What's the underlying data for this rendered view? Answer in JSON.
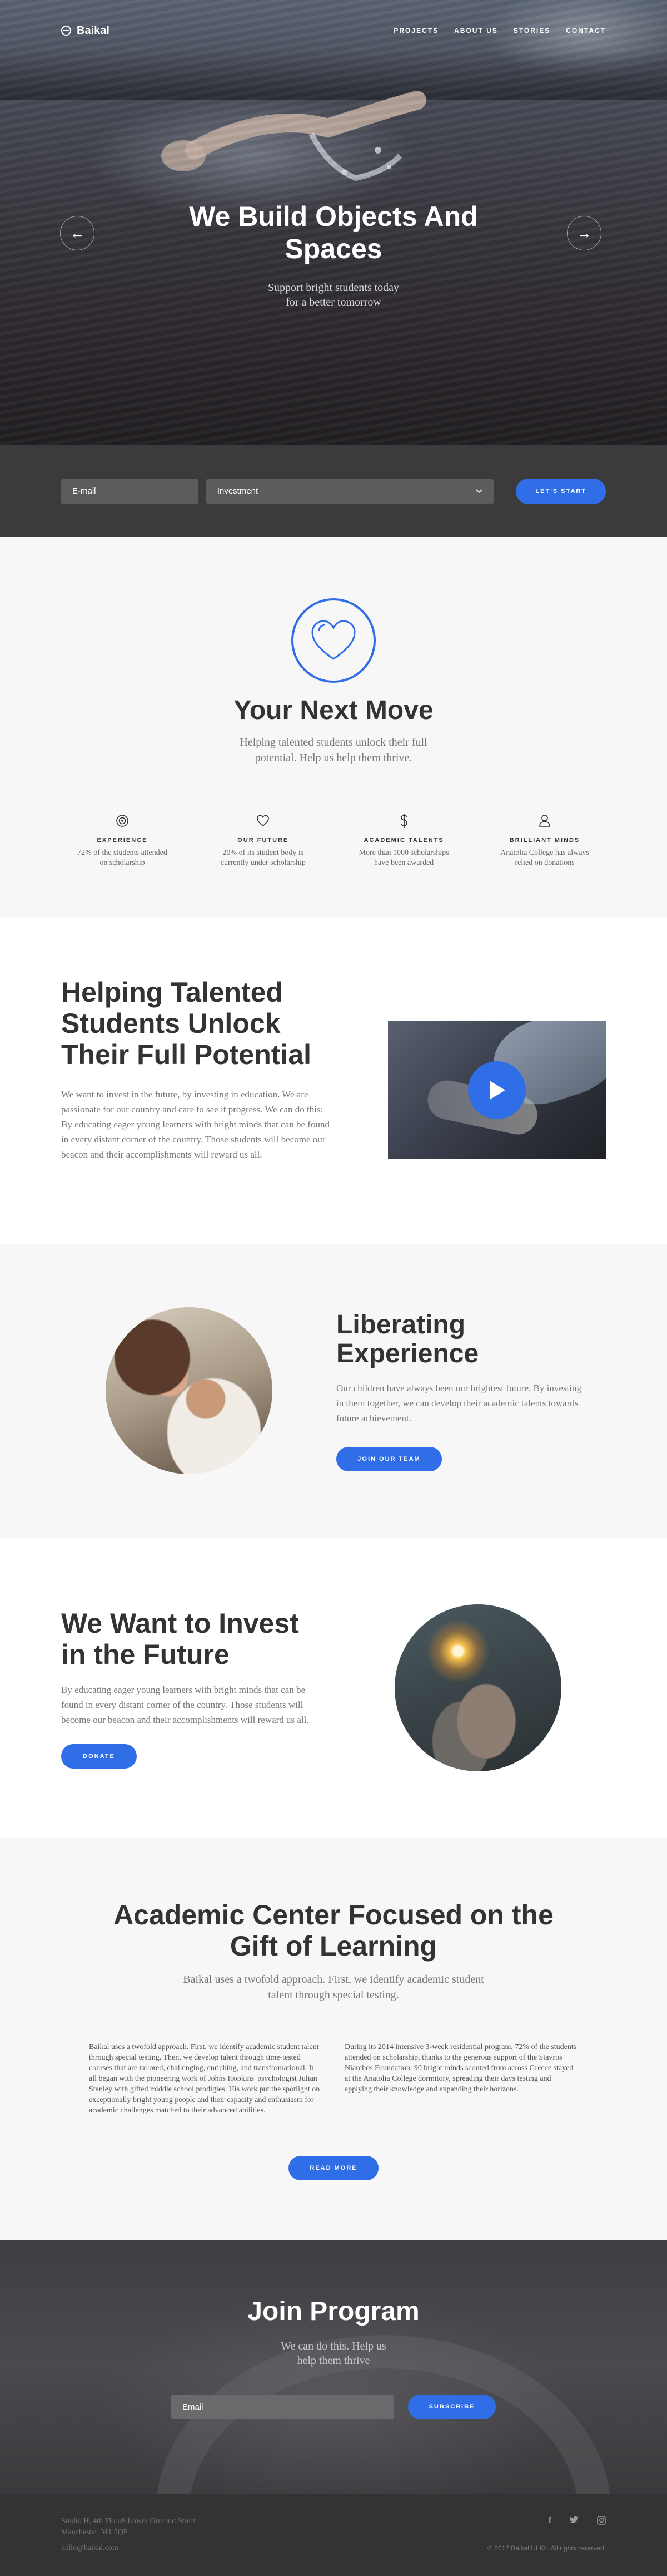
{
  "nav": {
    "brand": "Baikal",
    "items": [
      "PROJECTS",
      "ABOUT US",
      "STORIES",
      "CONTACT"
    ]
  },
  "hero": {
    "title": "We Build Objects And Spaces",
    "subtitle": "Support bright students today for a better tomorrow",
    "prev_icon": "arrow-left-icon",
    "next_icon": "arrow-right-icon"
  },
  "signup": {
    "email_placeholder": "E-mail",
    "select_value": "Investment",
    "button": "LET'S START"
  },
  "next_move": {
    "title": "Your Next Move",
    "subtitle": "Helping talented students unlock their full potential. Help us help them thrive.",
    "features": [
      {
        "icon": "target-icon",
        "title": "EXPERIENCE",
        "text": "72% of the students attended on scholarship"
      },
      {
        "icon": "heart-icon",
        "title": "OUR FUTURE",
        "text": "20% of its student body is currently under scholarship"
      },
      {
        "icon": "dollar-icon",
        "title": "ACADEMIC TALENTS",
        "text": "More than 1000 scholarships have been awarded"
      },
      {
        "icon": "user-icon",
        "title": "BRILLIANT MINDS",
        "text": "Anatolia College has always relied on donations"
      }
    ]
  },
  "helping": {
    "title": "Helping Talented Students Unlock Their Full Potential",
    "body": "We want to invest in the future, by investing in education. We are passionate for our country and care to see it progress. We can do this: By educating eager young learners with bright minds that can be found in every distant corner of the country. Those students will become our beacon and their accomplishments will reward us all."
  },
  "liberating": {
    "title": "Liberating Experience",
    "body": "Our children have always been our brightest future. By investing in them together, we can develop their academic talents towards future achievement.",
    "button": "JOIN OUR TEAM"
  },
  "invest": {
    "title": "We Want to Invest in the Future",
    "body": "By educating eager young learners with bright minds that can be found in every distant corner of the country. Those students will become our beacon and their accomplishments will reward us all.",
    "button": "DONATE"
  },
  "academic": {
    "title": "Academic Center Focused on the Gift of Learning",
    "subtitle": "Baikal uses a twofold approach. First, we identify academic student talent through special testing.",
    "col1": "Baikal uses a twofold approach. First, we identify academic student talent through special testing. Then, we develop talent through time-tested courses that are tailored, challenging, enriching, and transformational. It all began with the pioneering work of Johns Hopkins' psychologist Julian Stanley with gifted middle school prodigies. His work put the spotlight on exceptionally bright young people and their capacity and enthusiasm for academic challenges matched to their advanced abilities.",
    "col2": "During its 2014 intensive 3-week residential program, 72% of the students attended on scholarship, thanks to the generous support of the Stavros Niarchos Foundation. 90 bright minds scouted from across Greece stayed at the Anatolia College dormitory, spreading their days testing and applying their knowledge and expanding their horizons.",
    "button": "READ MORE"
  },
  "join": {
    "title": "Join Program",
    "subtitle": "We can do this. Help us help them thrive",
    "email_placeholder": "Email",
    "button": "SUBSCRIBE"
  },
  "footer": {
    "address_line1": "Studio H, 4th Floor8 Lower Ormond Street",
    "address_line2": "Manchester, M1 5QF",
    "email": "hello@baikal.com",
    "socials": [
      "facebook-icon",
      "twitter-icon",
      "instagram-icon"
    ],
    "copyright": "© 2017 Baikal UI Kit. All rights reserved."
  }
}
